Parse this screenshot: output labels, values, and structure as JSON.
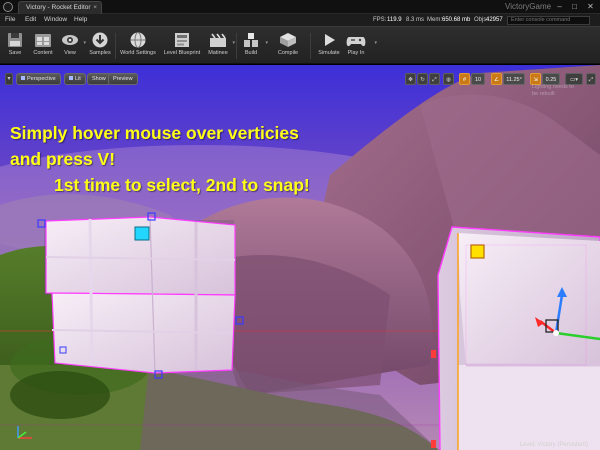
{
  "window": {
    "tab_title": "Victory - Rocket Editor",
    "project_name": "VictoryGame",
    "controls": [
      "–",
      "□",
      "✕"
    ]
  },
  "menu": {
    "items": [
      "File",
      "Edit",
      "Window",
      "Help"
    ]
  },
  "stats": {
    "fps_label": "FPS:",
    "fps": "119.9",
    "ms": "8.3 ms",
    "mem_label": "Mem:",
    "mem": "650.68 mb",
    "objs_label": "Objs:",
    "objs": "42957",
    "console_placeholder": "Enter console command"
  },
  "toolbar": {
    "buttons": [
      {
        "label": "Save",
        "icon": "save-icon"
      },
      {
        "label": "Content",
        "icon": "content-browser-icon"
      },
      {
        "label": "View",
        "icon": "eye-icon"
      },
      {
        "label": "Samples",
        "icon": "download-icon"
      },
      {
        "label": "World Settings",
        "icon": "globe-icon"
      },
      {
        "label": "Level Blueprint",
        "icon": "blueprint-icon"
      },
      {
        "label": "Matinee",
        "icon": "clapperboard-icon"
      },
      {
        "label": "Build",
        "icon": "build-blocks-icon"
      },
      {
        "label": "Compile",
        "icon": "compile-icon"
      },
      {
        "label": "Simulate",
        "icon": "play-triangle-icon"
      },
      {
        "label": "Play In",
        "icon": "gamepad-icon"
      }
    ]
  },
  "viewport": {
    "menu_button": "▾",
    "perspective": "Perspective",
    "lit": "Lit",
    "show": "Show",
    "preview": "Preview",
    "grid_snap": "10",
    "rotation_snap": "11.25°",
    "scale_snap": "0.25",
    "faint_text": [
      "Lighting needs to",
      "be rebuilt"
    ]
  },
  "overlay": {
    "line1": "Simply hover mouse over verticies",
    "line2": "and press V!",
    "line3": "1st time to select, 2nd to snap!",
    "level": "Level:  Victory (Persistent)"
  },
  "colors": {
    "tutorial_text": "#ffff17",
    "snap_active": "#c97a16",
    "selection": "#ff40ff",
    "vertex_blue": "#2a2aff"
  }
}
